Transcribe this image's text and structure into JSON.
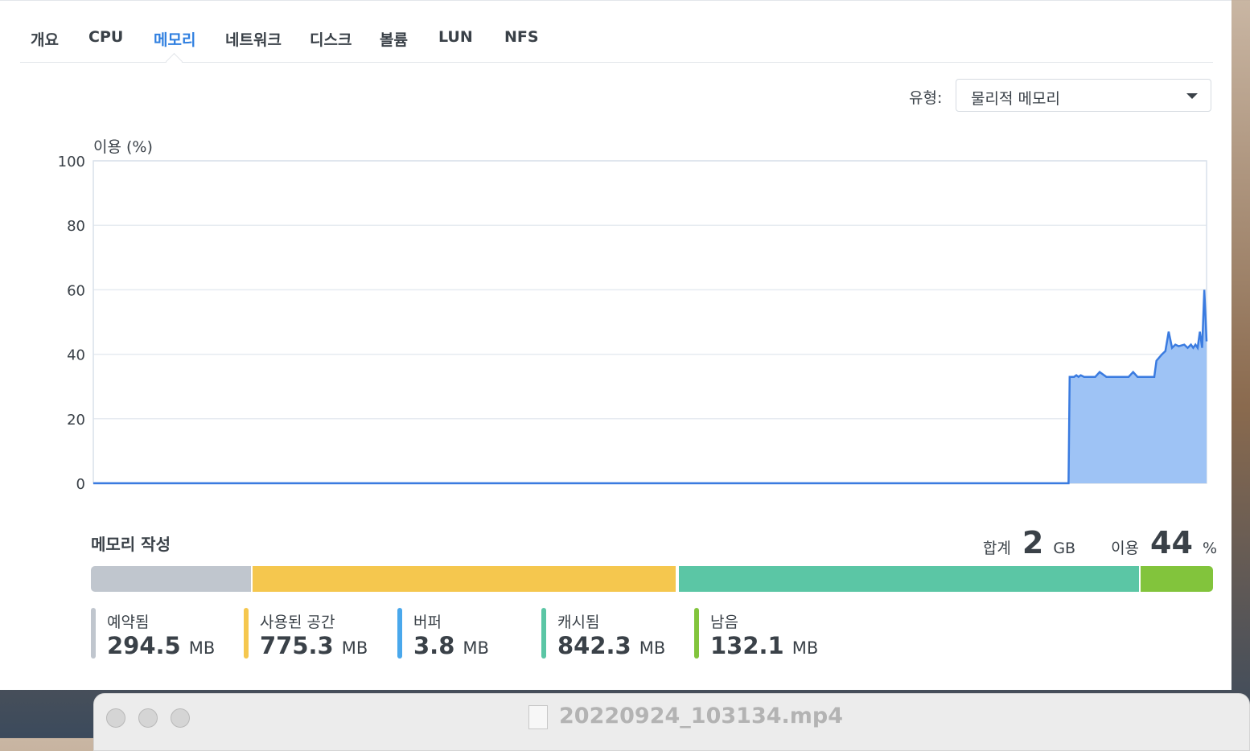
{
  "tabs": [
    "개요",
    "CPU",
    "메모리",
    "네트워크",
    "디스크",
    "볼륨",
    "LUN",
    "NFS"
  ],
  "active_tab": "메모리",
  "type_selector": {
    "label": "유형:",
    "value": "물리적 메모리"
  },
  "chart_data": {
    "type": "area",
    "ylabel": "이용 (%)",
    "ylim": [
      0,
      100
    ],
    "yticks": [
      "100",
      "80",
      "60",
      "40",
      "20",
      "0"
    ],
    "grid": true,
    "color": "#3a7be0",
    "fill": "#9ec3f5",
    "x": [
      0,
      87.6,
      87.7,
      88.1,
      88.3,
      88.5,
      88.7,
      89.0,
      89.3,
      89.6,
      90.0,
      90.4,
      91.0,
      91.5,
      92.0,
      92.3,
      92.6,
      93.0,
      93.4,
      93.8,
      94.2,
      95.0,
      95.3,
      95.5,
      96.0,
      96.3,
      96.6,
      96.9,
      97.2,
      97.5,
      98.0,
      98.3,
      98.6,
      98.8,
      99.0,
      99.2,
      99.4,
      99.6,
      99.8,
      100
    ],
    "y": [
      0,
      0,
      33,
      33,
      33.5,
      33,
      33.5,
      33,
      33,
      33,
      33,
      34.5,
      33,
      33,
      33,
      33,
      33,
      33,
      34.5,
      33,
      33,
      33,
      33,
      38,
      40,
      41,
      47,
      42,
      43,
      42.5,
      43,
      42,
      43,
      42,
      43,
      42,
      47,
      42,
      60,
      44
    ]
  },
  "composition": {
    "title": "메모리 작성",
    "total_label": "합계",
    "total_value": "2",
    "total_unit": "GB",
    "usage_label": "이용",
    "usage_value": "44",
    "usage_unit": "%",
    "segments": [
      {
        "name": "예약됨",
        "value": "294.5",
        "mb": 294.5,
        "unit": "MB",
        "color": "#c0c6ce"
      },
      {
        "name": "사용된 공간",
        "value": "775.3",
        "mb": 775.3,
        "unit": "MB",
        "color": "#f5c74e"
      },
      {
        "name": "버퍼",
        "value": "3.8",
        "mb": 3.8,
        "unit": "MB",
        "color": "#4aa8ec"
      },
      {
        "name": "캐시됨",
        "value": "842.3",
        "mb": 842.3,
        "unit": "MB",
        "color": "#5bc6a5"
      },
      {
        "name": "남음",
        "value": "132.1",
        "mb": 132.1,
        "unit": "MB",
        "color": "#82c43c"
      }
    ]
  },
  "player": {
    "filename": "20220924_103134.mp4"
  }
}
